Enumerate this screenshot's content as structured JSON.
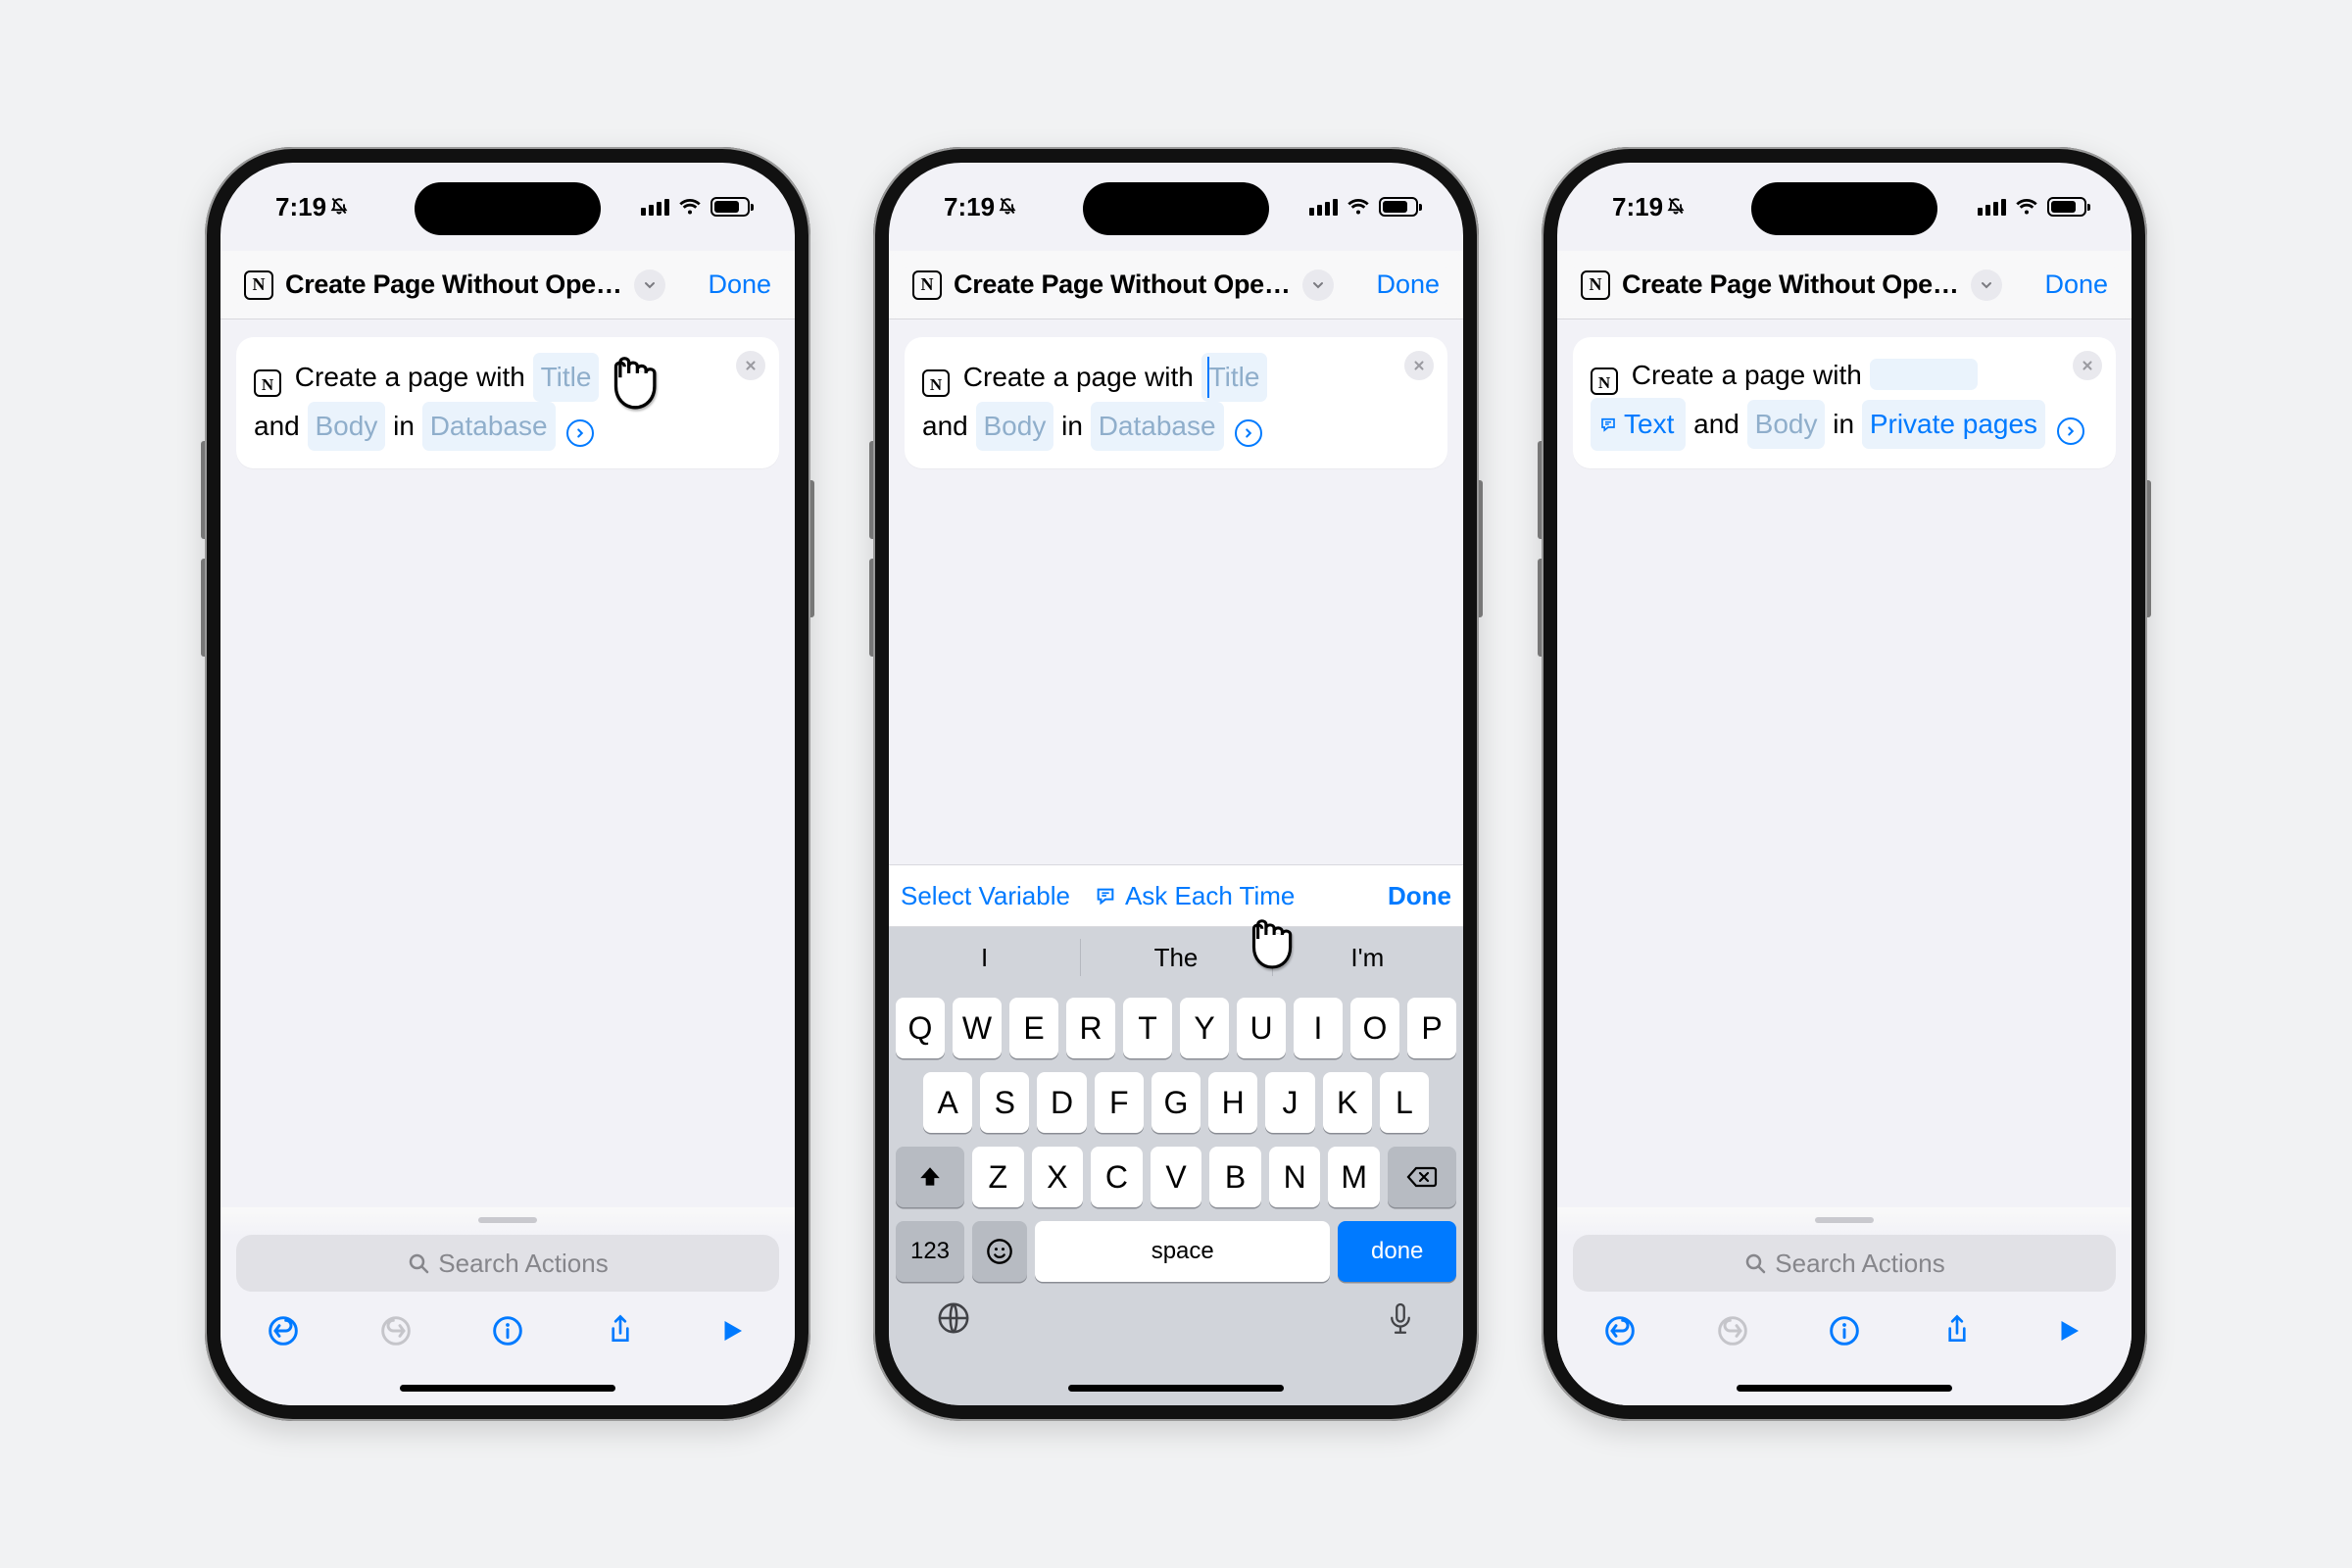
{
  "status": {
    "time": "7:19"
  },
  "nav": {
    "title": "Create Page Without Ope…",
    "done": "Done",
    "app_letter": "N"
  },
  "card": {
    "lead": "Create a page with",
    "title_token": "Title",
    "and": "and",
    "body_token": "Body",
    "in": "in",
    "db_token": "Database",
    "text_var": "Text",
    "private_pages": "Private pages"
  },
  "accessory": {
    "select_var": "Select Variable",
    "ask": "Ask Each Time",
    "done": "Done"
  },
  "pred": {
    "a": "I",
    "b": "The",
    "c": "I'm"
  },
  "kb": {
    "r1": [
      "Q",
      "W",
      "E",
      "R",
      "T",
      "Y",
      "U",
      "I",
      "O",
      "P"
    ],
    "r2": [
      "A",
      "S",
      "D",
      "F",
      "G",
      "H",
      "J",
      "K",
      "L"
    ],
    "r3": [
      "Z",
      "X",
      "C",
      "V",
      "B",
      "N",
      "M"
    ],
    "n123": "123",
    "space": "space",
    "done": "done"
  },
  "search": {
    "placeholder": "Search Actions"
  }
}
